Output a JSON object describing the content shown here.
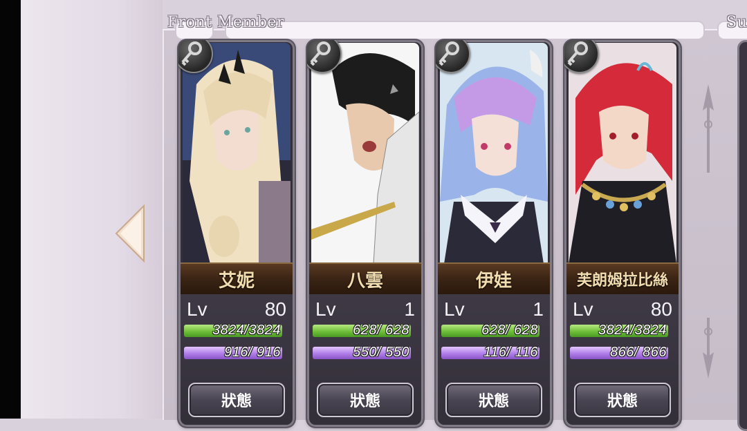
{
  "sections": {
    "front_label": "Front Member",
    "support_label": "Su"
  },
  "nav": {
    "prev_icon": "triangle-left-icon"
  },
  "cards": [
    {
      "name": "艾妮",
      "lv_label": "Lv",
      "lv": "80",
      "hp": "3824/3824",
      "mp": " 916/ 916",
      "button": "狀態"
    },
    {
      "name": "八雲",
      "lv_label": "Lv",
      "lv": "1",
      "hp": " 628/ 628",
      "mp": " 550/ 550",
      "button": "狀態"
    },
    {
      "name": "伊娃",
      "lv_label": "Lv",
      "lv": "1",
      "hp": " 628/ 628",
      "mp": " 116/ 116",
      "button": "狀態"
    },
    {
      "name": "芙朗姆拉比絲",
      "lv_label": "Lv",
      "lv": "80",
      "hp": "3824/3824",
      "mp": " 866/ 866",
      "button": "狀態"
    }
  ],
  "colors": {
    "hp_bar": "#6fbf3a",
    "mp_bar": "#b07ee8",
    "name_plate": "#3a2414",
    "name_text": "#f2ddb0"
  }
}
